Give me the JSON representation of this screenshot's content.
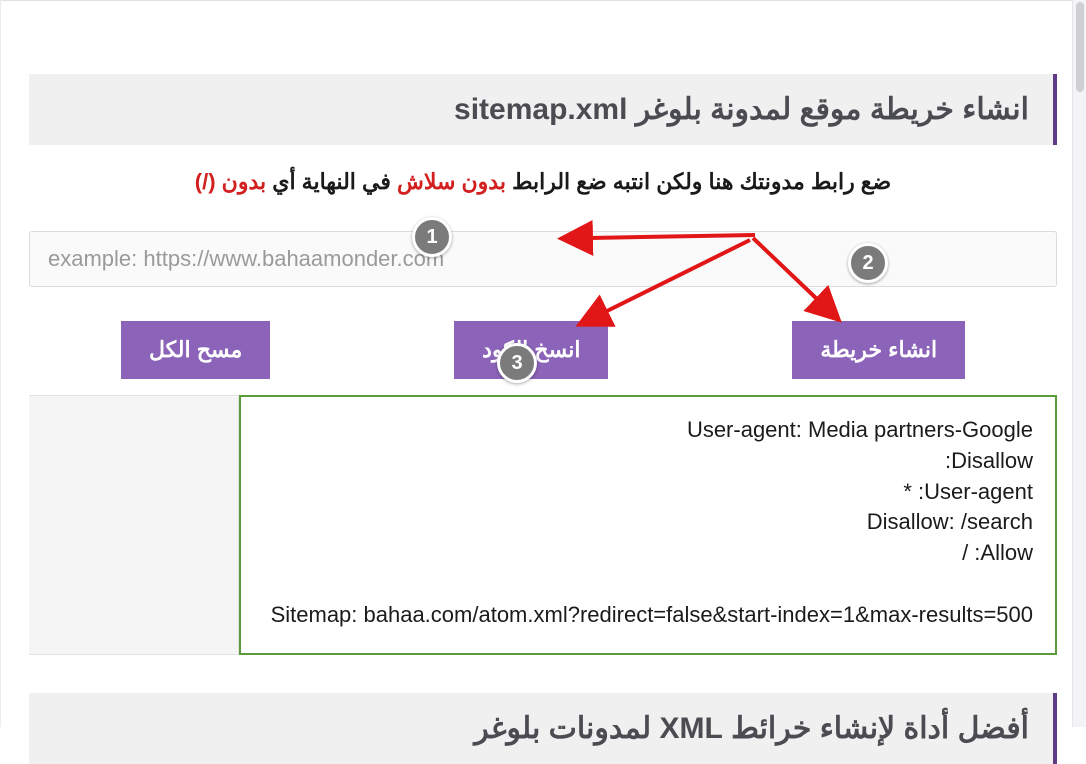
{
  "title": "انشاء خريطة موقع لمدونة بلوغر sitemap.xml",
  "instruction": {
    "lead": "ضع رابط مدونتك هنا ولكن انتبه ضع الرابط ",
    "red1": "بدون سلاش",
    "mid": " في النهاية أي ",
    "red2": "بدون (/)"
  },
  "input": {
    "placeholder": "example: https://www.bahaamonder.com",
    "value": ""
  },
  "buttons": {
    "generate": "انشاء خريطة",
    "copy": "انسخ الكود",
    "clear": "مسح الكل"
  },
  "output": "User-agent: Media partners-Google\nDisallow:\nUser-agent: *\nDisallow: /search\nAllow: /\n\nSitemap: bahaa.com/atom.xml?redirect=false&start-index=1&max-results=500",
  "second_title": "أفضل أداة لإنشاء خرائط XML لمدونات بلوغر",
  "annotations": {
    "step1": "1",
    "step2": "2",
    "step3": "3"
  }
}
